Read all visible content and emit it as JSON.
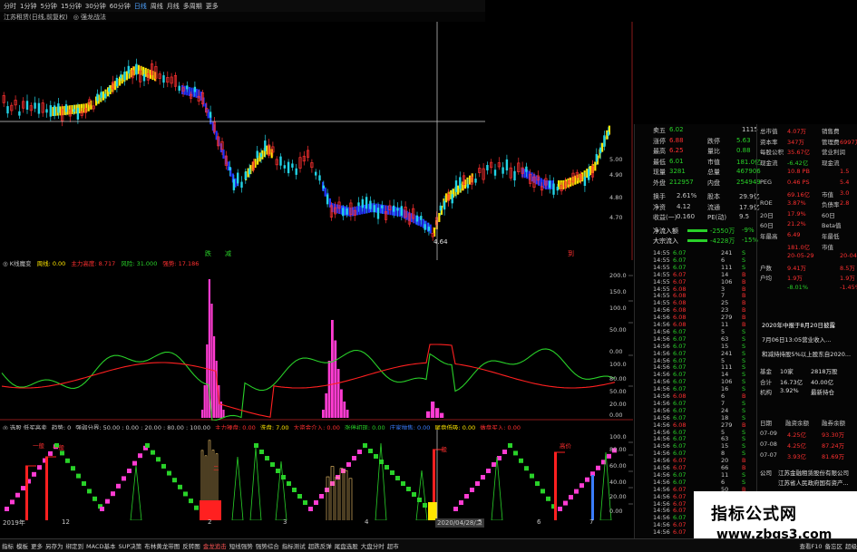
{
  "toolbar": {
    "periods": [
      "分时",
      "1分钟",
      "5分钟",
      "15分钟",
      "30分钟",
      "60分钟",
      "日线",
      "周线",
      "月线",
      "多周期",
      "更多"
    ],
    "active": "日线",
    "icons": [
      "arrow-up-icon",
      "arrow-down-icon"
    ]
  },
  "title": {
    "stock": "江苏租赁(日线,前复权)",
    "indicator": "◎ 强龙战法"
  },
  "main_chart": {
    "price_axis": [
      "5.00",
      "4.90",
      "4.80",
      "4.70",
      "4.64"
    ],
    "low_marker": "4.64",
    "markers": [
      "跌",
      "减",
      "到"
    ],
    "colors": {
      "up": "#ffe600",
      "down": "#2233ff",
      "candle_up": "#ff3030",
      "candle_down": "#22d3e6",
      "cross": "#d0d0d0"
    }
  },
  "ind1": {
    "label": "◎ K线魔变",
    "items": [
      {
        "text": "周线: 0.00",
        "color": "#ffe600"
      },
      {
        "text": "主力高度: 8.717",
        "color": "#ff3030"
      },
      {
        "text": "风险: 31.000",
        "color": "#29d129"
      },
      {
        "text": "强势: 17.186",
        "color": "#ff3030"
      }
    ],
    "axis": [
      "200.0",
      "150.0",
      "100.0",
      "50.00",
      "0.00",
      "100.0",
      "80.00",
      "50.00",
      "20.00",
      "0.00"
    ]
  },
  "ind2": {
    "label": "◎ 选股 低买高卖",
    "items": [
      {
        "text": "趋势: 0",
        "color": "#c8c8c8"
      },
      {
        "text": "强弱分界: 50.00 : 0.00 : 20.00 : 80.00 : 100.00",
        "color": "#c8c8c8"
      },
      {
        "text": "主力操盘: 0.00",
        "color": "#ff3030"
      },
      {
        "text": "洗盘: 7.00",
        "color": "#ffe600"
      },
      {
        "text": "大资金介入: 0.00",
        "color": "#ff3030"
      },
      {
        "text": "涨停初现: 0.00",
        "color": "#29d129"
      },
      {
        "text": "庄家抛售: 0.00",
        "color": "#3a7dff"
      },
      {
        "text": "尾盘低吸: 0.00",
        "color": "#ffe600"
      },
      {
        "text": "做盘买入: 0.00",
        "color": "#ff3030"
      }
    ],
    "axis": [
      "100.0",
      "80.00",
      "60.00",
      "40.00",
      "20.00",
      "0.00"
    ],
    "tags": [
      "一般",
      "一般",
      "二",
      "一般",
      "高价"
    ]
  },
  "date_axis": [
    "2019年",
    "12",
    "2",
    "3",
    "4",
    "2020/04/28/二",
    "5",
    "6",
    "7"
  ],
  "quote": {
    "rows": [
      {
        "l": "卖五",
        "v": "6.02",
        "r": "1115"
      },
      {
        "l": "涨停",
        "v": "6.88",
        "l2": "跌停",
        "v2": "5.63"
      },
      {
        "l": "最高",
        "v": "6.25",
        "l2": "量比",
        "v2": "0.88"
      },
      {
        "l": "最低",
        "v": "6.01",
        "l2": "市值",
        "v2": "181.0亿"
      },
      {
        "l": "现量",
        "v": "3281",
        "l2": "总量",
        "v2": "467906"
      },
      {
        "l": "外盘",
        "v": "212957",
        "l2": "内盘",
        "v2": "254949"
      }
    ],
    "rows2": [
      {
        "l": "换手",
        "v": "2.61%",
        "l2": "股本",
        "v2": "29.9亿"
      },
      {
        "l": "净资",
        "v": "4.12",
        "l2": "流通",
        "v2": "17.9亿"
      },
      {
        "l": "收益(一)",
        "v": "0.160",
        "l2": "PE(动)",
        "v2": "9.5"
      }
    ],
    "flow": [
      {
        "l": "净流入额",
        "v": "-2550万",
        "p": "-9%"
      },
      {
        "l": "大宗流入",
        "v": "-4228万",
        "p": "-15%"
      }
    ]
  },
  "ticks": {
    "rows": [
      [
        "14:55",
        "6.07",
        "241",
        "S"
      ],
      [
        "14:55",
        "6.07",
        "6",
        "S"
      ],
      [
        "14:55",
        "6.07",
        "111",
        "S"
      ],
      [
        "14:55",
        "6.07",
        "14",
        "B"
      ],
      [
        "14:55",
        "6.07",
        "106",
        "B"
      ],
      [
        "14:55",
        "6.08",
        "3",
        "B"
      ],
      [
        "14:55",
        "6.08",
        "7",
        "B"
      ],
      [
        "14:55",
        "6.08",
        "25",
        "B"
      ],
      [
        "14:56",
        "6.08",
        "23",
        "B"
      ],
      [
        "14:56",
        "6.08",
        "279",
        "B"
      ],
      [
        "14:56",
        "6.08",
        "11",
        "B"
      ],
      [
        "14:56",
        "6.07",
        "5",
        "S"
      ],
      [
        "14:56",
        "6.07",
        "63",
        "S"
      ],
      [
        "14:56",
        "6.07",
        "15",
        "S"
      ],
      [
        "14:56",
        "6.07",
        "241",
        "S"
      ],
      [
        "14:56",
        "6.07",
        "5",
        "S"
      ],
      [
        "14:56",
        "6.07",
        "111",
        "S"
      ],
      [
        "14:56",
        "6.07",
        "14",
        "S"
      ],
      [
        "14:56",
        "6.07",
        "106",
        "S"
      ],
      [
        "14:56",
        "6.07",
        "16",
        "S"
      ],
      [
        "14:56",
        "6.08",
        "6",
        "B"
      ],
      [
        "14:56",
        "6.07",
        "7",
        "S"
      ],
      [
        "14:56",
        "6.07",
        "24",
        "S"
      ],
      [
        "14:56",
        "6.07",
        "18",
        "S"
      ],
      [
        "14:56",
        "6.08",
        "279",
        "B"
      ],
      [
        "14:56",
        "6.07",
        "5",
        "S"
      ],
      [
        "14:56",
        "6.07",
        "63",
        "S"
      ],
      [
        "14:56",
        "6.07",
        "15",
        "S"
      ],
      [
        "14:56",
        "6.07",
        "8",
        "S"
      ],
      [
        "14:56",
        "6.07",
        "20",
        "B"
      ],
      [
        "14:56",
        "6.07",
        "66",
        "B"
      ],
      [
        "14:56",
        "6.07",
        "11",
        "S"
      ],
      [
        "14:56",
        "6.07",
        "6",
        "S"
      ],
      [
        "14:56",
        "6.07",
        "50",
        "B"
      ],
      [
        "14:56",
        "6.07",
        "19",
        "B"
      ],
      [
        "14:56",
        "6.07",
        "31",
        "B"
      ],
      [
        "14:56",
        "6.07",
        "67",
        "B"
      ],
      [
        "14:56",
        "6.07",
        "13",
        "S"
      ],
      [
        "14:56",
        "6.07",
        "119",
        "B"
      ],
      [
        "14:56",
        "6.07",
        "31",
        "B"
      ]
    ]
  },
  "fundamentals": {
    "rows": [
      {
        "l": "总市值",
        "v": "4.07万",
        "l2": "销售费",
        "v2": ""
      },
      {
        "l": "资本率",
        "v": "347万",
        "l2": "管理费",
        "v2": "6997万"
      },
      {
        "l": "每股公积",
        "v": "35.67亿",
        "l2": "营业利润",
        "v2": ""
      },
      {
        "l": "现金流",
        "v": "-6.42亿",
        "l2": "现金流",
        "v2": ""
      },
      {
        "l": "",
        "v": "10.8 PB",
        "l2": "",
        "v2": "1.5"
      },
      {
        "l": "PEG",
        "v": "0.46 PS",
        "l2": "",
        "v2": "5.4"
      },
      {
        "l": "",
        "v": "69.16亿",
        "l2": "市值",
        "v2": "3.0"
      },
      {
        "l": "ROE",
        "v": "3.87%",
        "l2": "负债率",
        "v2": "2.8"
      },
      {
        "l": "20日",
        "v": "17.9%",
        "l2": "60日",
        "v2": ""
      },
      {
        "l": "60日",
        "v": "21.2%",
        "l2": "Beta值",
        "v2": ""
      },
      {
        "l": "年最高",
        "v": "6.49",
        "l2": "年最低",
        "v2": ""
      },
      {
        "l": "",
        "v": "181.0亿",
        "l2": "市值",
        "v2": ""
      },
      {
        "l": "",
        "v": "20-05-29",
        "l2": "",
        "v2": "20-04-30"
      },
      {
        "l": "户数",
        "v": "9.41万",
        "l2": "",
        "v2": "8.5万"
      },
      {
        "l": "户均",
        "v": "1.9万",
        "l2": "",
        "v2": "1.9万"
      },
      {
        "l": "",
        "v": "-8.01%",
        "l2": "",
        "v2": "-1.45%"
      }
    ],
    "news": [
      "2020年中报于8月20日披露",
      "7月06日13:05营业收入...",
      "和减持持股5%以上股东自2020..."
    ],
    "holders": [
      {
        "l": "基金",
        "v": "10家",
        "v2": "2818万股"
      },
      {
        "l": "合计",
        "v": "16.73亿",
        "v2": "40.00亿"
      },
      {
        "l": "机构",
        "v": "3.92%",
        "v2": "最新持仓"
      }
    ],
    "table_head": [
      "日期",
      "融资余额",
      "融券余额"
    ],
    "table": [
      [
        "07-09",
        "4.25亿",
        "93.30万"
      ],
      [
        "07-08",
        "4.25亿",
        "87.24万"
      ],
      [
        "07-07",
        "3.93亿",
        "81.69万"
      ]
    ],
    "company": [
      "公司",
      "江苏金融租赁股份有限公司",
      "江苏省人民政府国有资产..."
    ]
  },
  "watermark": {
    "cn": "指标公式网",
    "url": "www.zbgs3.com"
  },
  "bottom": {
    "tabs": [
      "指标",
      "模板",
      "更多",
      "另存为",
      "绑定到",
      "MACD基本",
      "SUP决策",
      "布林黄龙带图",
      "反转图",
      "金龙追击",
      "短线强势",
      "强势综合",
      "指标测试",
      "超跌反弹",
      "尾盘选股",
      "大盘分时",
      "超市"
    ],
    "hot": [
      "金龙追击"
    ],
    "row2": [
      "扩展 · 天联股份",
      "交易量",
      "资金监控",
      "同题资讯",
      "专题资讯",
      "境外资金",
      "金属分析",
      "主力轨迹",
      "综合资讯",
      "行业资讯",
      "行业数据",
      "互动问答",
      "机构调研",
      "千股千评",
      "同花顺分析",
      "问股圈"
    ],
    "right": [
      "查看F10",
      "备忘区",
      "超级"
    ]
  }
}
